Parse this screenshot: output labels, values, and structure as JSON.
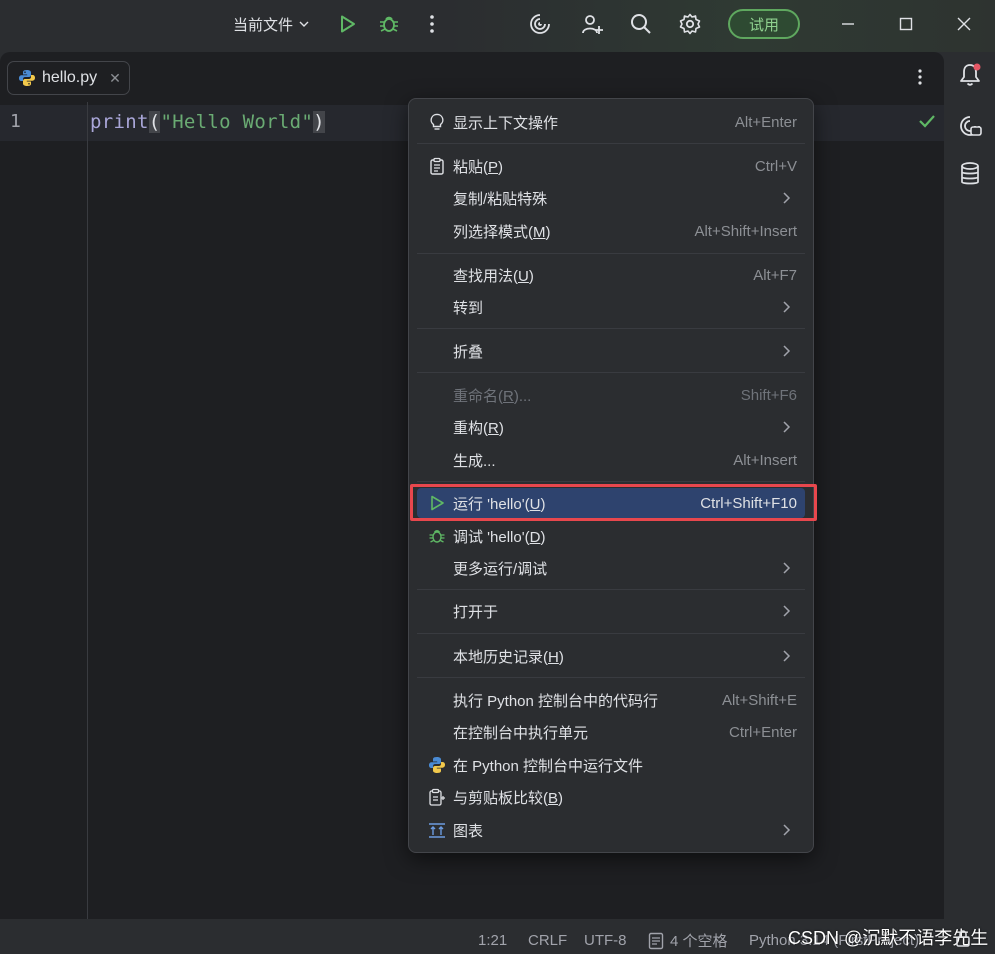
{
  "titlebar": {
    "run_config": "当前文件",
    "trial_button": "试用"
  },
  "editor": {
    "tab_label": "hello.py",
    "line_number": "1",
    "code": {
      "fn": "print",
      "open_paren": "(",
      "string": "\"Hello World\"",
      "close_paren": ")"
    }
  },
  "menu": {
    "items": [
      {
        "label": "显示上下文操作",
        "shortcut": "Alt+Enter"
      },
      {
        "label": "粘贴(P)",
        "shortcut": "Ctrl+V"
      },
      {
        "label": "复制/粘贴特殊",
        "shortcut": ""
      },
      {
        "label": "列选择模式(M)",
        "shortcut": "Alt+Shift+Insert"
      },
      {
        "label": "查找用法(U)",
        "shortcut": "Alt+F7"
      },
      {
        "label": "转到",
        "shortcut": ""
      },
      {
        "label": "折叠",
        "shortcut": ""
      },
      {
        "label": "重命名(R)...",
        "shortcut": "Shift+F6"
      },
      {
        "label": "重构(R)",
        "shortcut": ""
      },
      {
        "label": "生成...",
        "shortcut": "Alt+Insert"
      },
      {
        "label": "运行 'hello'(U)",
        "shortcut": "Ctrl+Shift+F10"
      },
      {
        "label": "调试 'hello'(D)",
        "shortcut": ""
      },
      {
        "label": "更多运行/调试",
        "shortcut": ""
      },
      {
        "label": "打开于",
        "shortcut": ""
      },
      {
        "label": "本地历史记录(H)",
        "shortcut": ""
      },
      {
        "label": "执行 Python 控制台中的代码行",
        "shortcut": "Alt+Shift+E"
      },
      {
        "label": "在控制台中执行单元",
        "shortcut": "Ctrl+Enter"
      },
      {
        "label": "在 Python 控制台中运行文件",
        "shortcut": ""
      },
      {
        "label": "与剪贴板比较(B)",
        "shortcut": ""
      },
      {
        "label": "图表",
        "shortcut": ""
      }
    ]
  },
  "statusbar": {
    "position": "1:21",
    "line_ending": "CRLF",
    "encoding": "UTF-8",
    "indent": "4 个空格",
    "interpreter": "Python 3.14 (FirstProject)"
  },
  "watermark": "CSDN @沉默不语李先生",
  "colors": {
    "accent_run": "#5fb865",
    "selection": "#2e436e",
    "highlight_border": "#e8474d",
    "string": "#6aab73"
  }
}
